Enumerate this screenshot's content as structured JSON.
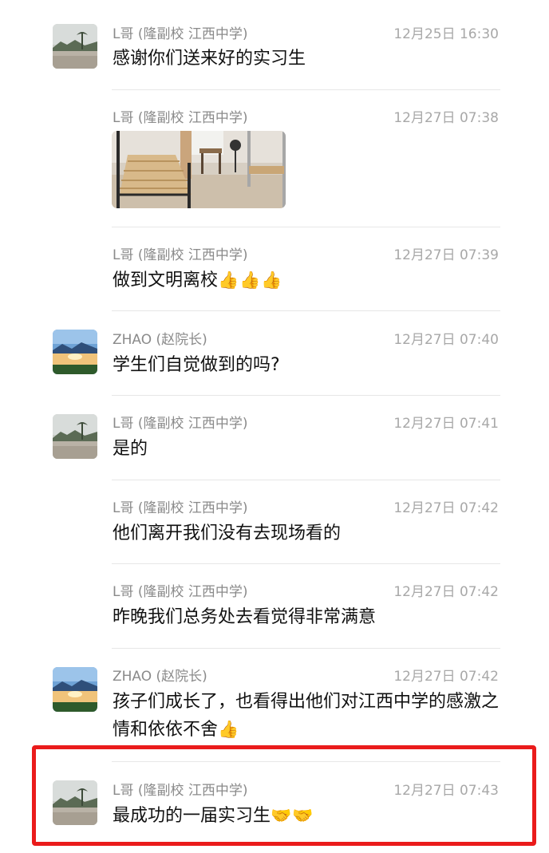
{
  "messages": [
    {
      "sender": "L哥 (隆副校 江西中学)",
      "time": "12月25日 16:30",
      "text": "感谢你们送来好的实习生",
      "emoji": ""
    },
    {
      "sender": "L哥 (隆副校 江西中学)",
      "time": "12月27日 07:38",
      "text": "",
      "emoji": ""
    },
    {
      "sender": "L哥 (隆副校 江西中学)",
      "time": "12月27日 07:39",
      "text": "做到文明离校",
      "emoji": "👍👍👍"
    },
    {
      "sender": "ZHAO (赵院长)",
      "time": "12月27日 07:40",
      "text": "学生们自觉做到的吗?",
      "emoji": ""
    },
    {
      "sender": "L哥 (隆副校 江西中学)",
      "time": "12月27日 07:41",
      "text": "是的",
      "emoji": ""
    },
    {
      "sender": "L哥 (隆副校 江西中学)",
      "time": "12月27日 07:42",
      "text": "他们离开我们没有去现场看的",
      "emoji": ""
    },
    {
      "sender": "L哥 (隆副校 江西中学)",
      "time": "12月27日 07:42",
      "text": "昨晚我们总务处去看觉得非常满意",
      "emoji": ""
    },
    {
      "sender": "ZHAO (赵院长)",
      "time": "12月27日 07:42",
      "text": "孩子们成长了，也看得出他们对江西中学的感激之情和依依不舍",
      "emoji": "👍"
    },
    {
      "sender": "L哥 (隆副校 江西中学)",
      "time": "12月27日 07:43",
      "text": "最成功的一届实习生",
      "emoji": "🤝🤝"
    }
  ],
  "icons": {
    "avatar_l": "avatar-landscape-icon",
    "avatar_zhao": "avatar-lake-sunset-icon",
    "photo": "dorm-room-photo"
  },
  "colors": {
    "highlight": "#ea1b1b",
    "sender": "#8a8a8a",
    "time": "#a8a8a8"
  }
}
